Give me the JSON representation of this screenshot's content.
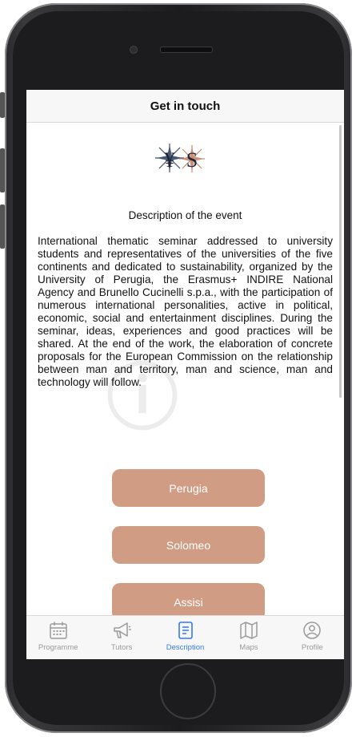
{
  "header": {
    "title": "Get in touch"
  },
  "logo": {
    "name": "star-logo"
  },
  "description": {
    "title": "Description of the event",
    "text": "International thematic seminar addressed to university students and representatives of the universities of the five continents and dedicated to sustainability, organized by the University of Perugia, the Erasmus+ INDIRE National Agency and Brunello Cucinelli s.p.a., with the participation of numerous international personalities, active in political, economic, social and entertainment disciplines. During the seminar, ideas, experiences and good practices will be shared. At the end of the work, the elaboration of concrete proposals for the European Commission on the relationship between man and territory, man and science, man and technology will follow."
  },
  "buttons": [
    {
      "label": "Perugia"
    },
    {
      "label": "Solomeo"
    },
    {
      "label": "Assisi"
    }
  ],
  "tabs": [
    {
      "label": "Programme",
      "icon": "calendar-icon",
      "active": false
    },
    {
      "label": "Tutors",
      "icon": "megaphone-icon",
      "active": false
    },
    {
      "label": "Description",
      "icon": "document-icon",
      "active": true
    },
    {
      "label": "Maps",
      "icon": "map-icon",
      "active": false
    },
    {
      "label": "Profile",
      "icon": "person-icon",
      "active": false
    }
  ],
  "colors": {
    "accent": "#d19c84",
    "tab_active": "#3478f6",
    "tab_inactive": "#9a9a9a",
    "logo_blue": "#3b4a6b",
    "logo_copper": "#c48a6e"
  }
}
